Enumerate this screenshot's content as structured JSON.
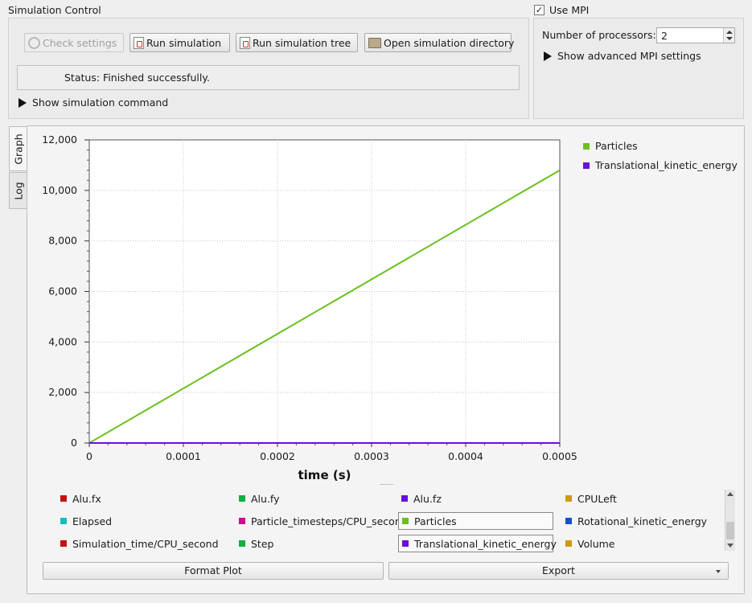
{
  "simulation_control": {
    "title": "Simulation Control",
    "check_settings_label": "Check settings",
    "run_simulation_label": "Run simulation",
    "run_simulation_tree_label": "Run simulation tree",
    "open_directory_label": "Open simulation directory",
    "status_text": "Status: Finished successfully.",
    "show_command_label": "Show simulation command"
  },
  "mpi": {
    "use_mpi_label": "Use MPI",
    "use_mpi_checked": "✓",
    "processors_label": "Number of processors:",
    "processors_value": "2",
    "advanced_label": "Show advanced MPI settings"
  },
  "tabs": {
    "graph": "Graph",
    "log": "Log"
  },
  "chart_data": {
    "type": "line",
    "xlabel": "time (s)",
    "ylabel": "",
    "xlim": [
      0,
      0.0005
    ],
    "ylim": [
      0,
      12000
    ],
    "x_ticks": [
      "0",
      "0.0001",
      "0.0002",
      "0.0003",
      "0.0004",
      "0.0005"
    ],
    "y_ticks": [
      "0",
      "2,000",
      "4,000",
      "6,000",
      "8,000",
      "10,000",
      "12,000"
    ],
    "grid": true,
    "legend_placement": "right",
    "series": [
      {
        "name": "Particles",
        "color": "#6cc020",
        "x": [
          0,
          0.0005
        ],
        "y": [
          0,
          10800
        ]
      },
      {
        "name": "Translational_kinetic_energy",
        "color": "#6a10d8",
        "x": [
          0,
          0.0005
        ],
        "y": [
          0,
          0
        ]
      }
    ]
  },
  "variables": [
    {
      "label": "Alu.fx",
      "color": "#cc1010",
      "selected": false
    },
    {
      "label": "Alu.fy",
      "color": "#10b040",
      "selected": false
    },
    {
      "label": "Alu.fz",
      "color": "#6a10d8",
      "selected": false
    },
    {
      "label": "CPULeft",
      "color": "#d09a10",
      "selected": false
    },
    {
      "label": "Elapsed",
      "color": "#10c0b8",
      "selected": false
    },
    {
      "label": "Particle_timesteps/CPU_second",
      "color": "#c81090",
      "selected": false
    },
    {
      "label": "Particles",
      "color": "#6cc020",
      "selected": true
    },
    {
      "label": "Rotational_kinetic_energy",
      "color": "#1050d8",
      "selected": false
    },
    {
      "label": "Simulation_time/CPU_second",
      "color": "#cc1010",
      "selected": false
    },
    {
      "label": "Step",
      "color": "#10b040",
      "selected": false
    },
    {
      "label": "Translational_kinetic_energy",
      "color": "#6a10d8",
      "selected": true
    },
    {
      "label": "Volume",
      "color": "#d09a10",
      "selected": false
    }
  ],
  "bottom": {
    "format_plot_label": "Format Plot",
    "export_label": "Export"
  }
}
